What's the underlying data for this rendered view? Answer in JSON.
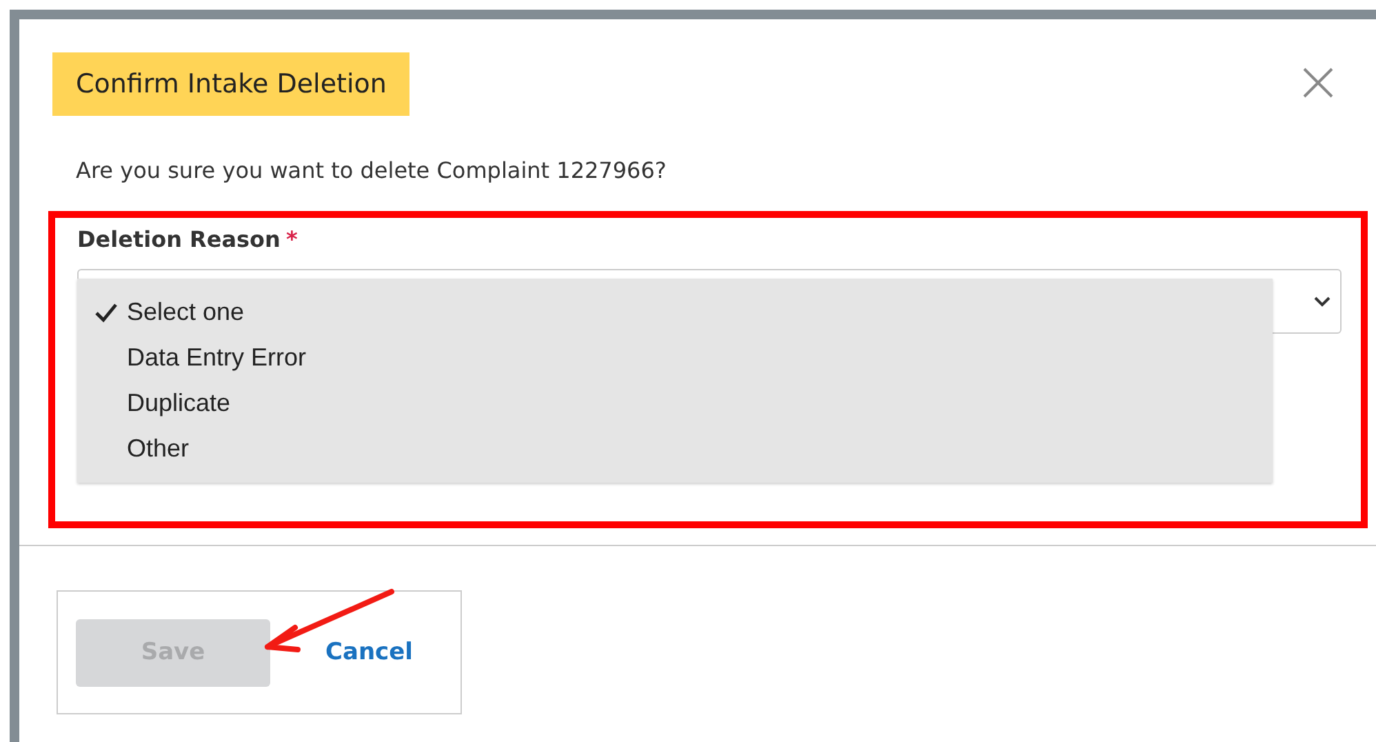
{
  "dialog": {
    "title": "Confirm Intake Deletion",
    "message": "Are you sure you want to delete Complaint 1227966?"
  },
  "field": {
    "label": "Deletion Reason",
    "required_mark": "*",
    "highlighted": true,
    "expanded": true,
    "options": [
      {
        "label": "Select one",
        "selected": true
      },
      {
        "label": "Data Entry Error",
        "selected": false
      },
      {
        "label": "Duplicate",
        "selected": false
      },
      {
        "label": "Other",
        "selected": false
      }
    ]
  },
  "buttons": [
    {
      "label": "Save",
      "kind": "primary",
      "disabled": true
    },
    {
      "label": "Cancel",
      "kind": "link",
      "disabled": false
    }
  ],
  "annotation": {
    "arrow_to_save": true
  }
}
